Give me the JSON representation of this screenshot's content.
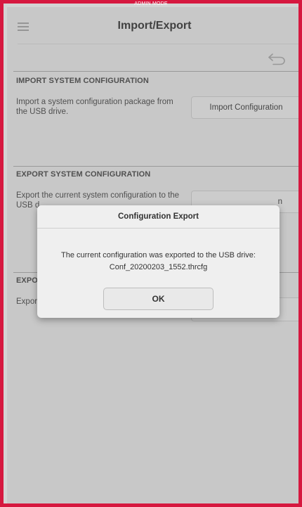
{
  "admin_label": "ADMIN MODE",
  "header": {
    "title": "Import/Export",
    "menu_icon": "hamburger-menu-icon",
    "back_icon": "back-arrow-icon"
  },
  "sections": [
    {
      "title": "IMPORT SYSTEM CONFIGURATION",
      "description": "Import a system configuration package from the USB drive.",
      "button_label": "Import Configuration"
    },
    {
      "title": "EXPORT SYSTEM CONFIGURATION",
      "description_visible": "Export the current system configuration to the",
      "description_line2_visible": "USB d",
      "button_label_visible": "n"
    },
    {
      "title_visible": "EXPO",
      "description_visible": "Expor"
    }
  ],
  "dialog": {
    "title": "Configuration Export",
    "message": "The current configuration was exported to the USB drive:",
    "filename": "Conf_20200203_1552.thrcfg",
    "ok_label": "OK"
  },
  "colors": {
    "frame_border": "#d6183f",
    "background": "#d3d3d3",
    "dialog_bg": "#efefef"
  }
}
